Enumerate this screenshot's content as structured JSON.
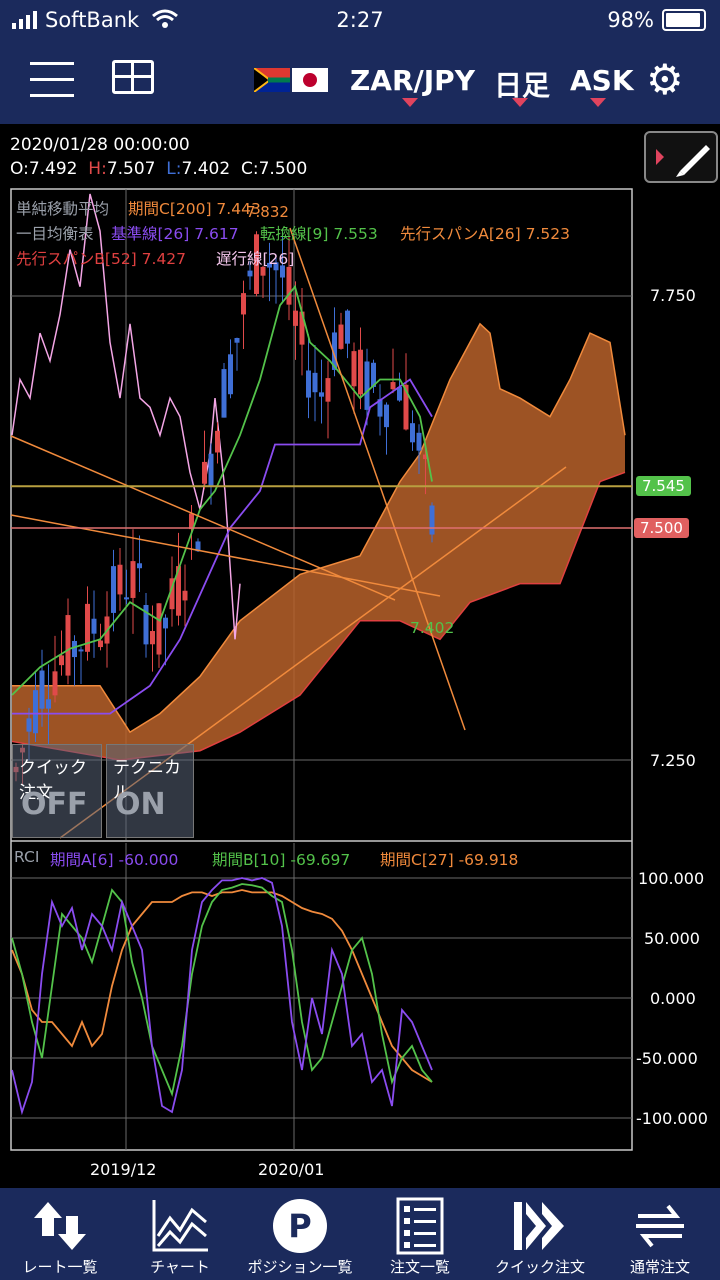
{
  "status_bar": {
    "carrier": "SoftBank",
    "time": "2:27",
    "battery": "98%"
  },
  "nav": {
    "pair": "ZAR/JPY",
    "timeframe": "日足",
    "side": "ASK"
  },
  "ohlc": {
    "date": "2020/01/28 00:00:00",
    "o_label": "O:",
    "o": "7.492",
    "h_label": "H:",
    "h": "7.507",
    "l_label": "L:",
    "l": "7.402",
    "c_label": "C:",
    "c": "7.500"
  },
  "legend": {
    "sma_name": "単純移動平均",
    "sma_period": "期間C[200] 7.443",
    "ichimoku_name": "一目均衡表",
    "kijun": "基準線[26] 7.617",
    "tenkan": "転換線[9] 7.553",
    "span_a": "先行スパンA[26] 7.523",
    "span_b": "先行スパンB[52] 7.427",
    "chikou": "遅行線[26]",
    "high_mark": "7.832",
    "low_mark": "7.402"
  },
  "price_axis": {
    "ticks": [
      "7.750",
      "7.250"
    ],
    "badge_green": "7.545",
    "badge_red": "7.500"
  },
  "overlay_buttons": {
    "quick_order": "クイック注文",
    "quick_state": "OFF",
    "technical": "テクニカル",
    "technical_state": "ON"
  },
  "rci": {
    "name": "RCI",
    "a": "期間A[6]",
    "a_val": "-60.000",
    "b": "期間B[10]",
    "b_val": "-69.697",
    "c": "期間C[27]",
    "c_val": "-69.918",
    "ticks": [
      "100.000",
      "50.000",
      "0.000",
      "-50.000",
      "-100.000"
    ]
  },
  "x_axis": {
    "labels": [
      "2019/12",
      "2020/01"
    ]
  },
  "colors": {
    "nav_bg": "#1b2a5c",
    "bull": "#e04a4a",
    "bear": "#3f6fd6",
    "tenkan": "#53c24a",
    "kijun": "#8a4cf0",
    "span_a": "#f08a3c",
    "span_b": "#e04040",
    "chikou": "#f4a6e6",
    "cloud": "#b8612a"
  },
  "tabs": [
    {
      "icon": "arrows-icon",
      "label": "レート一覧"
    },
    {
      "icon": "chart-icon",
      "label": "チャート"
    },
    {
      "icon": "position-icon",
      "label": "ポジション一覧"
    },
    {
      "icon": "order-list-icon",
      "label": "注文一覧"
    },
    {
      "icon": "quick-order-icon",
      "label": "クイック注文"
    },
    {
      "icon": "normal-order-icon",
      "label": "通常注文"
    }
  ],
  "chart_data": [
    {
      "type": "candlestick",
      "title": "ZAR/JPY 日足",
      "ylim": [
        7.15,
        7.9
      ],
      "visible_ticks": [
        7.25,
        7.75
      ],
      "last": {
        "open": 7.492,
        "high": 7.507,
        "low": 7.402,
        "close": 7.5
      },
      "period_high": 7.832,
      "period_low": 7.402,
      "indicators": {
        "sma200": 7.443,
        "kijun26": 7.617,
        "tenkan9": 7.553,
        "span_a26": 7.523,
        "span_b52": 7.427
      },
      "horizontal_lines": [
        7.545,
        7.5
      ]
    },
    {
      "type": "line",
      "title": "RCI",
      "ylim": [
        -100,
        100
      ],
      "series": [
        {
          "name": "期間A[6]",
          "last": -60.0
        },
        {
          "name": "期間B[10]",
          "last": -69.697
        },
        {
          "name": "期間C[27]",
          "last": -69.918
        }
      ]
    }
  ]
}
